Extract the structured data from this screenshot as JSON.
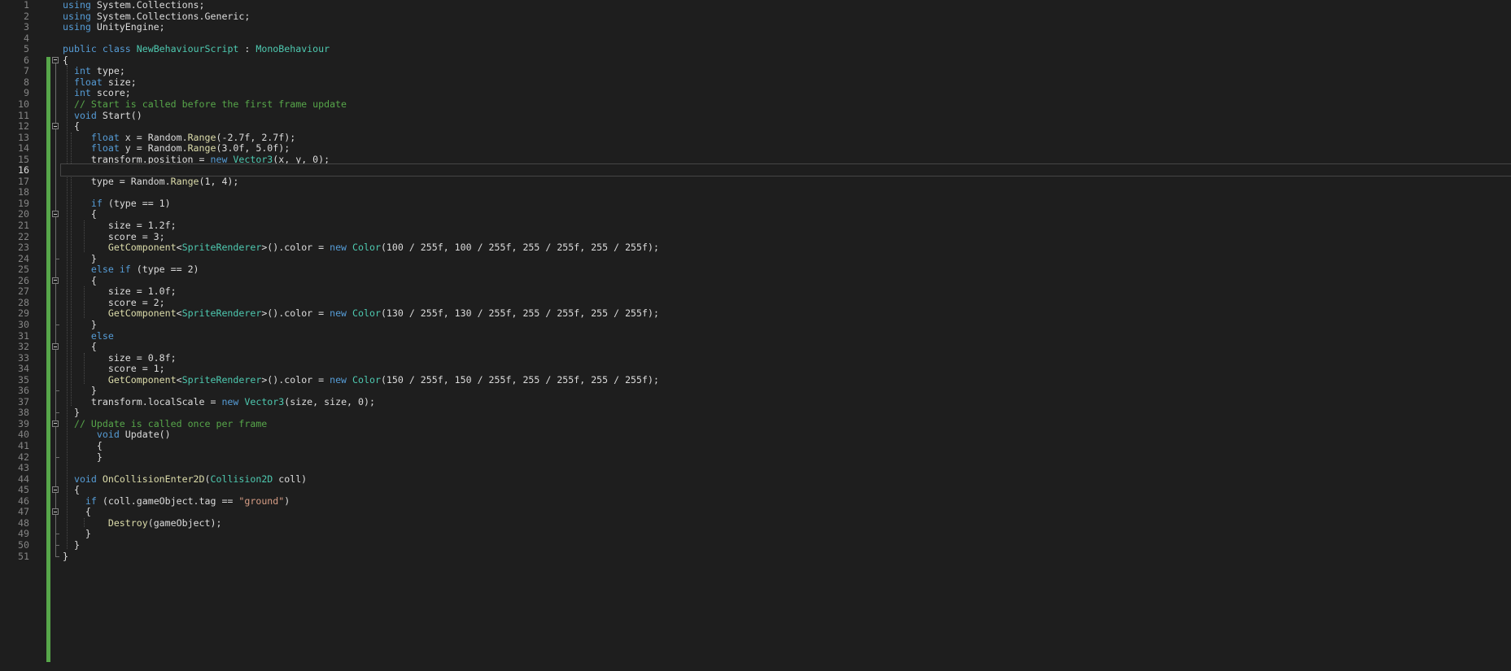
{
  "editor": {
    "current_line": 16,
    "lines": [
      {
        "n": "1",
        "tokens": [
          {
            "t": "using",
            "c": "kw"
          },
          {
            "t": " System.Collections;"
          }
        ]
      },
      {
        "n": "2",
        "tokens": [
          {
            "t": "using",
            "c": "kw"
          },
          {
            "t": " System.Collections.Generic;"
          }
        ]
      },
      {
        "n": "3",
        "tokens": [
          {
            "t": "using",
            "c": "kw"
          },
          {
            "t": " UnityEngine;"
          }
        ]
      },
      {
        "n": "4",
        "tokens": []
      },
      {
        "n": "5",
        "tokens": [
          {
            "t": "public",
            "c": "kw"
          },
          {
            "t": " "
          },
          {
            "t": "class",
            "c": "kw"
          },
          {
            "t": " "
          },
          {
            "t": "NewBehaviourScript",
            "c": "ty"
          },
          {
            "t": " : "
          },
          {
            "t": "MonoBehaviour",
            "c": "ty"
          }
        ]
      },
      {
        "n": "6",
        "tokens": [
          {
            "t": "{"
          }
        ]
      },
      {
        "n": "7",
        "tokens": [
          {
            "t": "  "
          },
          {
            "t": "int",
            "c": "kw"
          },
          {
            "t": " type;"
          }
        ]
      },
      {
        "n": "8",
        "tokens": [
          {
            "t": "  "
          },
          {
            "t": "float",
            "c": "kw"
          },
          {
            "t": " size;"
          }
        ]
      },
      {
        "n": "9",
        "tokens": [
          {
            "t": "  "
          },
          {
            "t": "int",
            "c": "kw"
          },
          {
            "t": " score;"
          }
        ]
      },
      {
        "n": "10",
        "tokens": [
          {
            "t": "  "
          },
          {
            "t": "// Start is called before the first frame update",
            "c": "cm"
          }
        ]
      },
      {
        "n": "11",
        "tokens": [
          {
            "t": "  "
          },
          {
            "t": "void",
            "c": "kw"
          },
          {
            "t": " Start()"
          }
        ]
      },
      {
        "n": "12",
        "tokens": [
          {
            "t": "  {"
          }
        ]
      },
      {
        "n": "13",
        "tokens": [
          {
            "t": "     "
          },
          {
            "t": "float",
            "c": "kw"
          },
          {
            "t": " x = Random."
          },
          {
            "t": "Range",
            "c": "fn"
          },
          {
            "t": "(-2.7f, 2.7f);"
          }
        ]
      },
      {
        "n": "14",
        "tokens": [
          {
            "t": "     "
          },
          {
            "t": "float",
            "c": "kw"
          },
          {
            "t": " y = Random."
          },
          {
            "t": "Range",
            "c": "fn"
          },
          {
            "t": "(3.0f, 5.0f);"
          }
        ]
      },
      {
        "n": "15",
        "tokens": [
          {
            "t": "     transform.position = "
          },
          {
            "t": "new",
            "c": "kw"
          },
          {
            "t": " "
          },
          {
            "t": "Vector3",
            "c": "ty"
          },
          {
            "t": "(x, y, 0);"
          }
        ]
      },
      {
        "n": "16",
        "tokens": []
      },
      {
        "n": "17",
        "tokens": [
          {
            "t": "     type = Random."
          },
          {
            "t": "Range",
            "c": "fn"
          },
          {
            "t": "(1, 4);"
          }
        ]
      },
      {
        "n": "18",
        "tokens": []
      },
      {
        "n": "19",
        "tokens": [
          {
            "t": "     "
          },
          {
            "t": "if",
            "c": "kw"
          },
          {
            "t": " (type == 1)"
          }
        ]
      },
      {
        "n": "20",
        "tokens": [
          {
            "t": "     {"
          }
        ]
      },
      {
        "n": "21",
        "tokens": [
          {
            "t": "        size = 1.2f;"
          }
        ]
      },
      {
        "n": "22",
        "tokens": [
          {
            "t": "        score = 3;"
          }
        ]
      },
      {
        "n": "23",
        "tokens": [
          {
            "t": "        "
          },
          {
            "t": "GetComponent",
            "c": "fn"
          },
          {
            "t": "<"
          },
          {
            "t": "SpriteRenderer",
            "c": "ty"
          },
          {
            "t": ">().color = "
          },
          {
            "t": "new",
            "c": "kw"
          },
          {
            "t": " "
          },
          {
            "t": "Color",
            "c": "ty"
          },
          {
            "t": "(100 / 255f, 100 / 255f, 255 / 255f, 255 / 255f);"
          }
        ]
      },
      {
        "n": "24",
        "tokens": [
          {
            "t": "     }"
          }
        ]
      },
      {
        "n": "25",
        "tokens": [
          {
            "t": "     "
          },
          {
            "t": "else",
            "c": "kw"
          },
          {
            "t": " "
          },
          {
            "t": "if",
            "c": "kw"
          },
          {
            "t": " (type == 2)"
          }
        ]
      },
      {
        "n": "26",
        "tokens": [
          {
            "t": "     {"
          }
        ]
      },
      {
        "n": "27",
        "tokens": [
          {
            "t": "        size = 1.0f;"
          }
        ]
      },
      {
        "n": "28",
        "tokens": [
          {
            "t": "        score = 2;"
          }
        ]
      },
      {
        "n": "29",
        "tokens": [
          {
            "t": "        "
          },
          {
            "t": "GetComponent",
            "c": "fn"
          },
          {
            "t": "<"
          },
          {
            "t": "SpriteRenderer",
            "c": "ty"
          },
          {
            "t": ">().color = "
          },
          {
            "t": "new",
            "c": "kw"
          },
          {
            "t": " "
          },
          {
            "t": "Color",
            "c": "ty"
          },
          {
            "t": "(130 / 255f, 130 / 255f, 255 / 255f, 255 / 255f);"
          }
        ]
      },
      {
        "n": "30",
        "tokens": [
          {
            "t": "     }"
          }
        ]
      },
      {
        "n": "31",
        "tokens": [
          {
            "t": "     "
          },
          {
            "t": "else",
            "c": "kw"
          }
        ]
      },
      {
        "n": "32",
        "tokens": [
          {
            "t": "     {"
          }
        ]
      },
      {
        "n": "33",
        "tokens": [
          {
            "t": "        size = 0.8f;"
          }
        ]
      },
      {
        "n": "34",
        "tokens": [
          {
            "t": "        score = 1;"
          }
        ]
      },
      {
        "n": "35",
        "tokens": [
          {
            "t": "        "
          },
          {
            "t": "GetComponent",
            "c": "fn"
          },
          {
            "t": "<"
          },
          {
            "t": "SpriteRenderer",
            "c": "ty"
          },
          {
            "t": ">().color = "
          },
          {
            "t": "new",
            "c": "kw"
          },
          {
            "t": " "
          },
          {
            "t": "Color",
            "c": "ty"
          },
          {
            "t": "(150 / 255f, 150 / 255f, 255 / 255f, 255 / 255f);"
          }
        ]
      },
      {
        "n": "36",
        "tokens": [
          {
            "t": "     }"
          }
        ]
      },
      {
        "n": "37",
        "tokens": [
          {
            "t": "     transform.localScale = "
          },
          {
            "t": "new",
            "c": "kw"
          },
          {
            "t": " "
          },
          {
            "t": "Vector3",
            "c": "ty"
          },
          {
            "t": "(size, size, 0);"
          }
        ]
      },
      {
        "n": "38",
        "tokens": [
          {
            "t": "  }"
          }
        ]
      },
      {
        "n": "39",
        "tokens": [
          {
            "t": "  "
          },
          {
            "t": "// Update is called once per frame",
            "c": "cm"
          }
        ]
      },
      {
        "n": "40",
        "tokens": [
          {
            "t": "      "
          },
          {
            "t": "void",
            "c": "kw"
          },
          {
            "t": " Update()"
          }
        ]
      },
      {
        "n": "41",
        "tokens": [
          {
            "t": "      {"
          }
        ]
      },
      {
        "n": "42",
        "tokens": [
          {
            "t": "      }"
          }
        ]
      },
      {
        "n": "43",
        "tokens": []
      },
      {
        "n": "44",
        "tokens": [
          {
            "t": "  "
          },
          {
            "t": "void",
            "c": "kw"
          },
          {
            "t": " "
          },
          {
            "t": "OnCollisionEnter2D",
            "c": "fn"
          },
          {
            "t": "("
          },
          {
            "t": "Collision2D",
            "c": "ty"
          },
          {
            "t": " coll)"
          }
        ]
      },
      {
        "n": "45",
        "tokens": [
          {
            "t": "  {"
          }
        ]
      },
      {
        "n": "46",
        "tokens": [
          {
            "t": "    "
          },
          {
            "t": "if",
            "c": "kw"
          },
          {
            "t": " (coll.gameObject.tag == "
          },
          {
            "t": "\"ground\"",
            "c": "st"
          },
          {
            "t": ")"
          }
        ]
      },
      {
        "n": "47",
        "tokens": [
          {
            "t": "    {"
          }
        ]
      },
      {
        "n": "48",
        "tokens": [
          {
            "t": "        "
          },
          {
            "t": "Destroy",
            "c": "fn"
          },
          {
            "t": "(gameObject);"
          }
        ]
      },
      {
        "n": "49",
        "tokens": [
          {
            "t": "    }"
          }
        ]
      },
      {
        "n": "50",
        "tokens": [
          {
            "t": "  }"
          }
        ]
      },
      {
        "n": "51",
        "tokens": [
          {
            "t": "}"
          }
        ]
      }
    ],
    "fold_lines": [
      6,
      12,
      20,
      26,
      32,
      39,
      45,
      47
    ],
    "colors": {
      "background": "#1e1e1e",
      "keyword": "#569cd6",
      "type": "#4ec9b0",
      "method": "#dcdcaa",
      "comment": "#57a64a",
      "string": "#d69d85",
      "line_number": "#858585",
      "change_bar": "#57a64a"
    }
  }
}
